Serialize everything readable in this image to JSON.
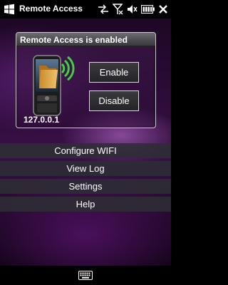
{
  "titlebar": {
    "title": "Remote Access",
    "icons": [
      "windows-start-icon",
      "data-connection-icon",
      "signal-off-icon",
      "volume-muted-icon",
      "battery-icon",
      "close-icon"
    ]
  },
  "panel": {
    "title": "Remote Access is enabled",
    "device_image": "phone-folder-wireless-icon",
    "ip_address": "127.0.0.1",
    "enable_label": "Enable",
    "disable_label": "Disable"
  },
  "menu": {
    "items": [
      {
        "label": "Configure WIFI"
      },
      {
        "label": "View Log"
      },
      {
        "label": "Settings"
      },
      {
        "label": "Help"
      }
    ]
  },
  "bottombar": {
    "icon": "keyboard-icon"
  },
  "colors": {
    "accent_green": "#3fd13f",
    "menu_bg": "#2d2d34",
    "background": "#2a0b36"
  }
}
